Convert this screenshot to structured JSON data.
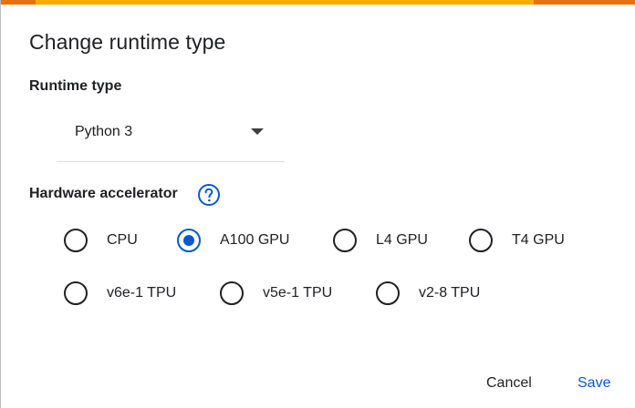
{
  "dialog": {
    "title": "Change runtime type",
    "accent_colors": [
      "#e8710a",
      "#f9ab00",
      "#e8710a"
    ]
  },
  "runtime": {
    "label": "Runtime type",
    "selected": "Python 3"
  },
  "hardware": {
    "label": "Hardware accelerator",
    "help_icon": "question-mark-circle-icon",
    "selected": "A100 GPU",
    "options": [
      {
        "label": "CPU",
        "checked": false
      },
      {
        "label": "A100 GPU",
        "checked": true
      },
      {
        "label": "L4 GPU",
        "checked": false
      },
      {
        "label": "T4 GPU",
        "checked": false
      },
      {
        "label": "v6e-1 TPU",
        "checked": false
      },
      {
        "label": "v5e-1 TPU",
        "checked": false
      },
      {
        "label": "v2-8 TPU",
        "checked": false
      }
    ]
  },
  "actions": {
    "cancel_label": "Cancel",
    "save_label": "Save",
    "primary_color": "#0b57d0"
  }
}
